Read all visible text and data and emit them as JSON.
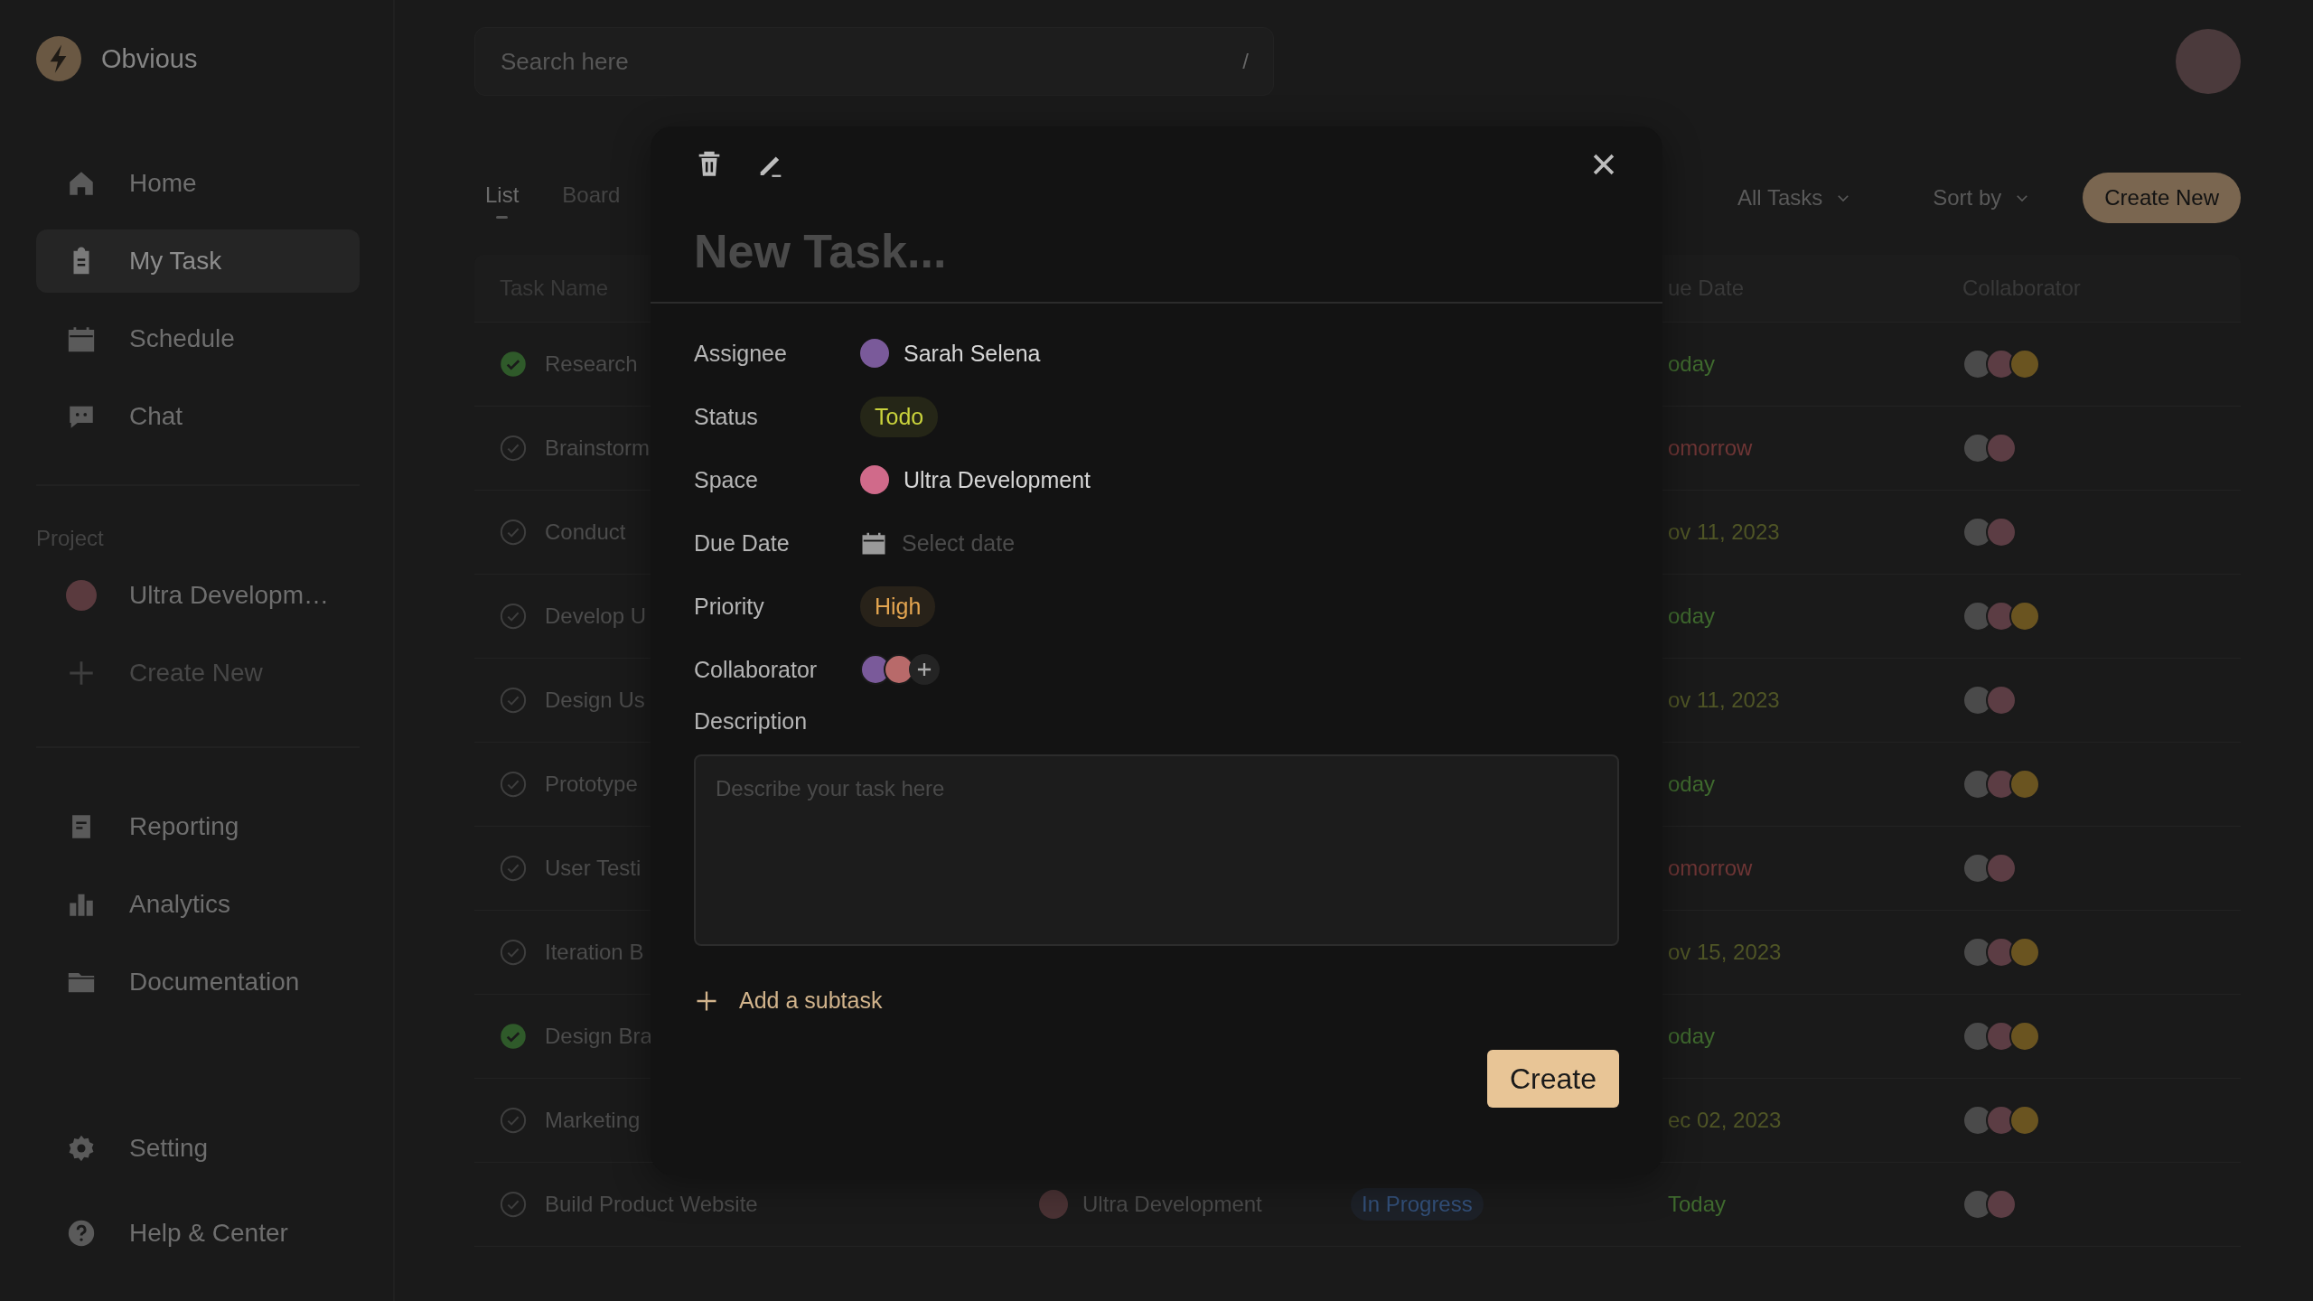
{
  "app": {
    "name": "Obvious"
  },
  "sidebar": {
    "nav": [
      {
        "label": "Home",
        "selected": false
      },
      {
        "label": "My Task",
        "selected": true
      },
      {
        "label": "Schedule",
        "selected": false
      },
      {
        "label": "Chat",
        "selected": false
      }
    ],
    "project_heading": "Project",
    "projects": [
      {
        "label": "Ultra Developm…",
        "kind": "project"
      },
      {
        "label": "Create New",
        "kind": "create"
      }
    ],
    "tools": [
      {
        "label": "Reporting"
      },
      {
        "label": "Analytics"
      },
      {
        "label": "Documentation"
      }
    ],
    "footer": [
      {
        "label": "Setting"
      },
      {
        "label": "Help & Center"
      }
    ]
  },
  "search": {
    "placeholder": "Search here",
    "shortcut": "/"
  },
  "view_tabs": [
    {
      "label": "List",
      "selected": true
    },
    {
      "label": "Board",
      "selected": false
    }
  ],
  "filters": [
    {
      "label": "All Tasks"
    },
    {
      "label": "Sort by"
    }
  ],
  "create_button": "Create New",
  "table": {
    "columns": [
      {
        "label": "Task Name",
        "kind": "task"
      },
      {
        "label": "ue Date",
        "kind": "due"
      },
      {
        "label": "Collaborator",
        "kind": "collab"
      }
    ],
    "rows": [
      {
        "done": true,
        "task": "Research",
        "due": {
          "text": "oday",
          "color": "#3f6a2e"
        },
        "collaborators": [
          {
            "color": "#4a4a4a"
          },
          {
            "color": "#5c3d44"
          },
          {
            "color": "#6a5420"
          }
        ]
      },
      {
        "done": false,
        "task": "Brainstorm",
        "due": {
          "text": "omorrow",
          "color": "#6e3535"
        },
        "collaborators": [
          {
            "color": "#4a4a4a"
          },
          {
            "color": "#5c3d44"
          }
        ]
      },
      {
        "done": false,
        "task": "Conduct",
        "due": {
          "text": "ov 11, 2023",
          "color": "#4f5526"
        },
        "collaborators": [
          {
            "color": "#4a4a4a"
          },
          {
            "color": "#5c3d44"
          }
        ]
      },
      {
        "done": false,
        "task": "Develop U",
        "due": {
          "text": "oday",
          "color": "#3f6a2e"
        },
        "collaborators": [
          {
            "color": "#4a4a4a"
          },
          {
            "color": "#5c3d44"
          },
          {
            "color": "#6a5420"
          }
        ]
      },
      {
        "done": false,
        "task": "Design Us",
        "due": {
          "text": "ov 11, 2023",
          "color": "#4f5526"
        },
        "collaborators": [
          {
            "color": "#4a4a4a"
          },
          {
            "color": "#5c3d44"
          }
        ]
      },
      {
        "done": false,
        "task": "Prototype",
        "due": {
          "text": "oday",
          "color": "#3f6a2e"
        },
        "collaborators": [
          {
            "color": "#4a4a4a"
          },
          {
            "color": "#5c3d44"
          },
          {
            "color": "#6a5420"
          }
        ]
      },
      {
        "done": false,
        "task": "User Testi",
        "due": {
          "text": "omorrow",
          "color": "#6e3535"
        },
        "collaborators": [
          {
            "color": "#4a4a4a"
          },
          {
            "color": "#5c3d44"
          }
        ]
      },
      {
        "done": false,
        "task": "Iteration B",
        "due": {
          "text": "ov 15, 2023",
          "color": "#4f5526"
        },
        "collaborators": [
          {
            "color": "#4a4a4a"
          },
          {
            "color": "#5c3d44"
          },
          {
            "color": "#6a5420"
          }
        ]
      },
      {
        "done": true,
        "task": "Design Bra",
        "due": {
          "text": "oday",
          "color": "#3f6a2e"
        },
        "collaborators": [
          {
            "color": "#4a4a4a"
          },
          {
            "color": "#5c3d44"
          },
          {
            "color": "#6a5420"
          }
        ]
      },
      {
        "done": false,
        "task": "Marketing",
        "due": {
          "text": "ec 02, 2023",
          "color": "#4f5526"
        },
        "collaborators": [
          {
            "color": "#4a4a4a"
          },
          {
            "color": "#5c3d44"
          },
          {
            "color": "#6a5420"
          }
        ]
      },
      {
        "done": false,
        "task": "Build Product Website",
        "space": "Ultra Development",
        "status": "In Progress",
        "due": {
          "text": "Today",
          "color": "#3f6a2e"
        },
        "collaborators": [
          {
            "color": "#4a4a4a"
          },
          {
            "color": "#5c3d44"
          }
        ]
      }
    ]
  },
  "modal": {
    "title_placeholder": "New Task...",
    "fields": [
      {
        "label": "Assignee",
        "kind": "person",
        "value": "Sarah Selena",
        "color": "#7a5a9a"
      },
      {
        "label": "Status",
        "kind": "badge",
        "value": "Todo",
        "color": "#c9d23c"
      },
      {
        "label": "Space",
        "kind": "person",
        "value": "Ultra Development",
        "color": "#d06a8a"
      },
      {
        "label": "Due Date",
        "kind": "date",
        "placeholder": "Select date"
      },
      {
        "label": "Priority",
        "kind": "badge",
        "value": "High",
        "color": "#e3a550"
      },
      {
        "label": "Collaborator",
        "kind": "avatars",
        "avatars": [
          {
            "color": "#7a5a9a"
          },
          {
            "color": "#b86a6a"
          }
        ]
      }
    ],
    "description": {
      "label": "Description",
      "placeholder": "Describe your task here"
    },
    "add_subtask": "Add a subtask",
    "submit": "Create"
  }
}
